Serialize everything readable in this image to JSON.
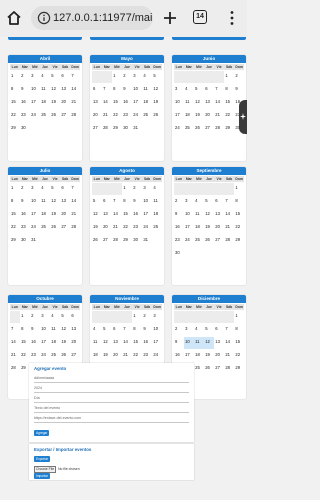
{
  "browser": {
    "url": "127.0.0.1:11977/main/",
    "tab_count": "14"
  },
  "day_headers": [
    "Lun",
    "Mar",
    "Mié",
    "Jue",
    "Vie",
    "Sáb",
    "Dom"
  ],
  "months": [
    {
      "name": "Abril",
      "offset": 0,
      "days": 30
    },
    {
      "name": "Mayo",
      "offset": 2,
      "days": 31
    },
    {
      "name": "Junio",
      "offset": 5,
      "days": 30
    },
    {
      "name": "Julio",
      "offset": 0,
      "days": 31
    },
    {
      "name": "Agosto",
      "offset": 3,
      "days": 31
    },
    {
      "name": "Septiembre",
      "offset": 6,
      "days": 30
    },
    {
      "name": "Octubre",
      "offset": 1,
      "days": 31
    },
    {
      "name": "Noviembre",
      "offset": 4,
      "days": 30
    },
    {
      "name": "Diciembre",
      "offset": 6,
      "days": 31,
      "highlighted_days": [
        10,
        11,
        12
      ]
    }
  ],
  "add_event": {
    "title": "Agregar evento",
    "date_value": "dd/mm/aaaa",
    "hour_value": "2024",
    "type_value": "Día",
    "text_placeholder": "Texto del evento",
    "url_placeholder": "https://enlace-del-evento.com",
    "button_label": "Agregar"
  },
  "export_import": {
    "title": "Exportar / Importar eventos",
    "export_button": "Exportar",
    "file_button": "Choose File",
    "file_status": "No file chosen",
    "import_button": "Importar"
  },
  "colors": {
    "accent": "#1e7fd0",
    "highlight": "#cfe5f8",
    "empty_cell": "#ececec"
  }
}
